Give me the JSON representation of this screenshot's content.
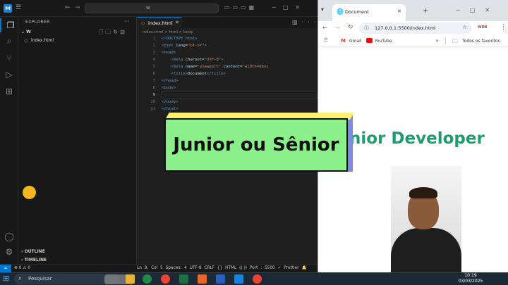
{
  "vscode": {
    "search_text": "w",
    "explorer_label": "EXPLORER",
    "folder_name": "W",
    "file_name": "index.html",
    "tab_label": "index.html",
    "breadcrumb": "index.html  >  html  >  body",
    "outline_label": "OUTLINE",
    "timeline_label": "TIMELINE",
    "code_lines": [
      {
        "n": "1",
        "cur": false,
        "parts": [
          [
            "tag",
            "<!DOCTYPE "
          ],
          [
            "doc",
            "html"
          ],
          [
            "tag",
            ">"
          ]
        ]
      },
      {
        "n": "2",
        "cur": false,
        "parts": [
          [
            "tag",
            "<html "
          ],
          [
            "em",
            "lang"
          ],
          [
            "txt",
            "="
          ],
          [
            "str",
            "\"pt-br\""
          ],
          [
            "tag",
            ">"
          ]
        ]
      },
      {
        "n": "3",
        "cur": false,
        "parts": [
          [
            "tag",
            "<head>"
          ]
        ]
      },
      {
        "n": "4",
        "cur": false,
        "parts": [
          [
            "txt",
            "    "
          ],
          [
            "tag",
            "<meta "
          ],
          [
            "em",
            "charset"
          ],
          [
            "txt",
            "="
          ],
          [
            "str",
            "\"UTF-8\""
          ],
          [
            "tag",
            ">"
          ]
        ]
      },
      {
        "n": "5",
        "cur": false,
        "parts": [
          [
            "txt",
            "    "
          ],
          [
            "tag",
            "<meta "
          ],
          [
            "em",
            "name"
          ],
          [
            "txt",
            "="
          ],
          [
            "str",
            "\"viewport\" "
          ],
          [
            "em",
            "content"
          ],
          [
            "txt",
            "="
          ],
          [
            "str",
            "\"width=devi"
          ]
        ]
      },
      {
        "n": "6",
        "cur": false,
        "parts": [
          [
            "txt",
            "    "
          ],
          [
            "tag",
            "<title>"
          ],
          [
            "txt",
            "Document"
          ],
          [
            "tag",
            "</title>"
          ]
        ]
      },
      {
        "n": "7",
        "cur": false,
        "parts": [
          [
            "tag",
            "</head>"
          ]
        ]
      },
      {
        "n": "8",
        "cur": false,
        "parts": [
          [
            "tag",
            "<body>"
          ]
        ]
      },
      {
        "n": "9",
        "cur": true,
        "parts": []
      },
      {
        "n": "10",
        "cur": false,
        "parts": [
          [
            "tag",
            "</body>"
          ]
        ]
      },
      {
        "n": "11",
        "cur": false,
        "parts": [
          [
            "tag",
            "</html>"
          ]
        ]
      }
    ],
    "status": {
      "errors": "⊗ 0 ⚠ 0",
      "right": "Ln 9, Col 5   Spaces: 4   UTF-8   CRLF   {} HTML   ((·)) Port : 5500   ✓ Prettier   🔔"
    },
    "accent_color": "#0078d4"
  },
  "chrome": {
    "tab_title": "Document",
    "url": "127.0.0.1:5500/index.html",
    "extension_label": "WDB",
    "bookmarks": {
      "gmail": "Gmail",
      "youtube": "YouTube",
      "all_bookmarks": "Todos os favoritos"
    },
    "page_heading": "nior Developer",
    "heading_color": "#1f9b6e"
  },
  "overlay": {
    "title_card": "Junior ou Sênior",
    "card_color": "#8cf08a"
  },
  "taskbar": {
    "search_placeholder": "Pesquisar",
    "time": "10:19",
    "date": "03/03/2025"
  }
}
